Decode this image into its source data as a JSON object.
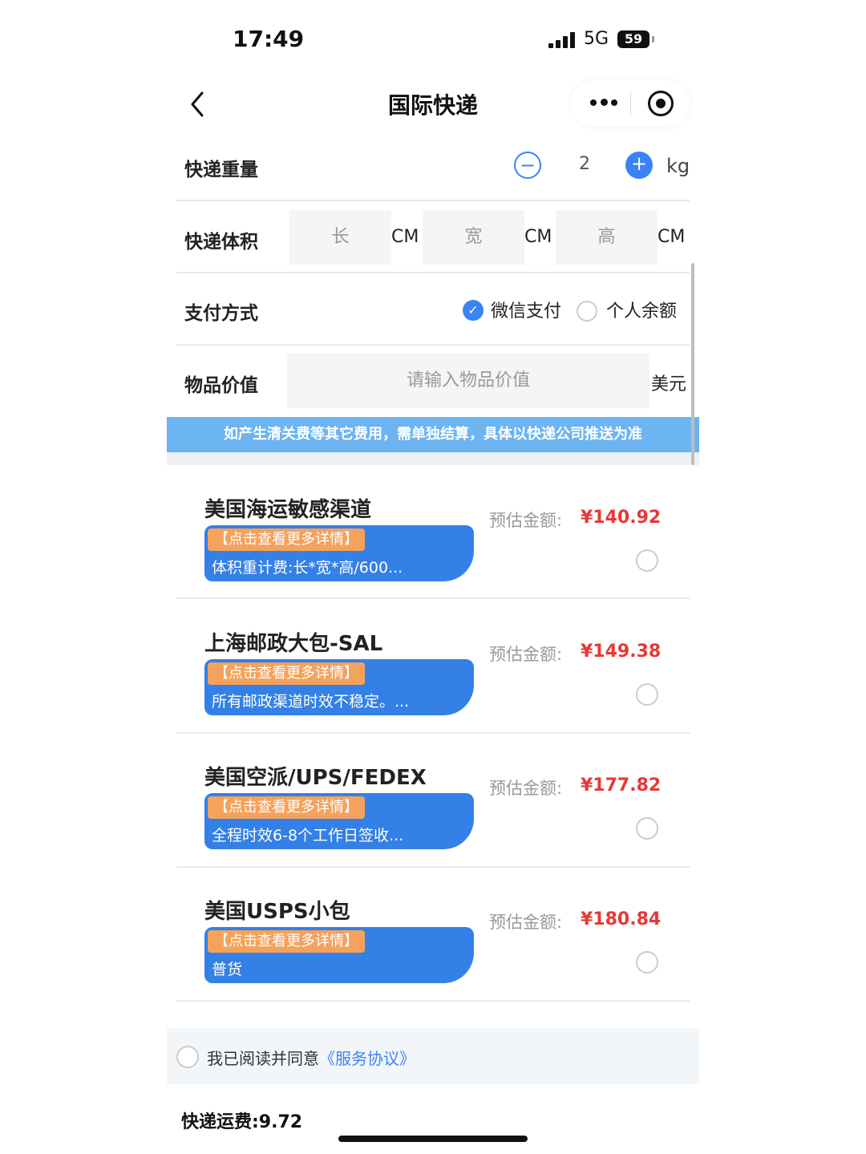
{
  "status_bar": {
    "time": "17:49",
    "network": "5G",
    "battery": "59"
  },
  "nav": {
    "title": "国际快递",
    "back_icon": "chevron-left-icon",
    "more_icon": "more-dots-icon",
    "close_icon": "target-circle-icon"
  },
  "weight": {
    "label": "快递重量",
    "value": "2",
    "unit": "kg",
    "minus": "−",
    "plus": "+"
  },
  "volume": {
    "label": "快递体积",
    "fields": [
      {
        "placeholder": "长",
        "unit": "CM"
      },
      {
        "placeholder": "宽",
        "unit": "CM"
      },
      {
        "placeholder": "高",
        "unit": "CM"
      }
    ]
  },
  "payment": {
    "label": "支付方式",
    "options": [
      {
        "label": "微信支付",
        "selected": true
      },
      {
        "label": "个人余额",
        "selected": false
      }
    ]
  },
  "item_value": {
    "label": "物品价值",
    "placeholder": "请输入物品价值",
    "unit": "美元"
  },
  "notice": "如产生清关费等其它费用，需单独结算，具体以快递公司推送为准",
  "options": [
    {
      "name": "美国海运敏感渠道",
      "tag": "【点击查看更多详情】",
      "desc": "体积重计费:长*宽*高/600...",
      "price_label": "预估金额:",
      "price": "¥140.92"
    },
    {
      "name": "上海邮政大包-SAL",
      "tag": "【点击查看更多详情】",
      "desc": "所有邮政渠道时效不稳定。...",
      "price_label": "预估金额:",
      "price": "¥149.38"
    },
    {
      "name": "美国空派/UPS/FEDEX",
      "tag": "【点击查看更多详情】",
      "desc": "全程时效6-8个工作日签收...",
      "price_label": "预估金额:",
      "price": "¥177.82"
    },
    {
      "name": "美国USPS小包",
      "tag": "【点击查看更多详情】",
      "desc": "普货",
      "price_label": "预估金额:",
      "price": "¥180.84"
    }
  ],
  "agreement": {
    "text": "我已阅读并同意",
    "link": "《服务协议》"
  },
  "fee": "快递运费:9.72",
  "colors": {
    "accent": "#3b82f6",
    "card": "#3380e6",
    "tag": "#f5a25d",
    "price": "#e53935",
    "notice": "#6db4f2"
  }
}
